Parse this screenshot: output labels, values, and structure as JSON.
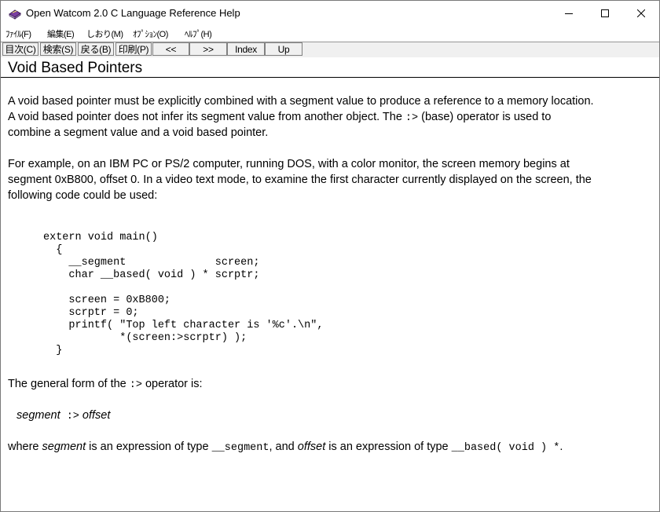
{
  "window": {
    "title": "Open Watcom 2.0 C Language Reference Help"
  },
  "menu": [
    {
      "label": "ﾌｧｲﾙ(F)"
    },
    {
      "label": "編集(E)"
    },
    {
      "label": "しおり(M)"
    },
    {
      "label": "ｵﾌﾟｼｮﾝ(O)"
    },
    {
      "label": "ﾍﾙﾌﾟ(H)"
    }
  ],
  "toolbar": [
    {
      "label": "目次(C)"
    },
    {
      "label": "検索(S)"
    },
    {
      "label": "戻る(B)"
    },
    {
      "label": "印刷(P)"
    },
    {
      "label": "<<"
    },
    {
      "label": ">>"
    },
    {
      "label": "Index"
    },
    {
      "label": "Up"
    }
  ],
  "topic": {
    "title": "Void Based Pointers"
  },
  "content": {
    "p1": [
      "A void based pointer must be explicitly combined with a segment value to produce a reference to a memory location.",
      "A void based pointer does not infer its segment value from another object.  The ",
      "(base) operator is used to",
      "combine a segment value and a void based pointer."
    ],
    "p1_op": ":>",
    "p2": [
      "For example, on an IBM PC or PS/2 computer, running DOS, with a color monitor, the screen memory begins at",
      "segment 0xB800, offset 0.  In a video text mode, to examine the first character currently displayed on the screen, the",
      "following code could be used:"
    ],
    "code": "extern void main()\n  {\n    __segment              screen;\n    char __based( void ) * scrptr;\n\n    screen = 0xB800;\n    scrptr = 0;\n    printf( \"Top left character is '%c'.\\n\",\n            *(screen:>scrptr) );\n  }",
    "p3_prefix": "The general form of the ",
    "p3_op": ":>",
    "p3_suffix": " operator is:",
    "syntax_segment": "segment",
    "syntax_op": ":>",
    "syntax_offset": "offset",
    "p4_where": "where ",
    "p4_segment": "segment",
    "p4_mid1": " is an expression of type ",
    "p4_type1": "__segment",
    "p4_mid2": ", and ",
    "p4_offset": "offset",
    "p4_mid3": " is an expression of type ",
    "p4_type2": "__based( void ) *",
    "p4_end": "."
  }
}
